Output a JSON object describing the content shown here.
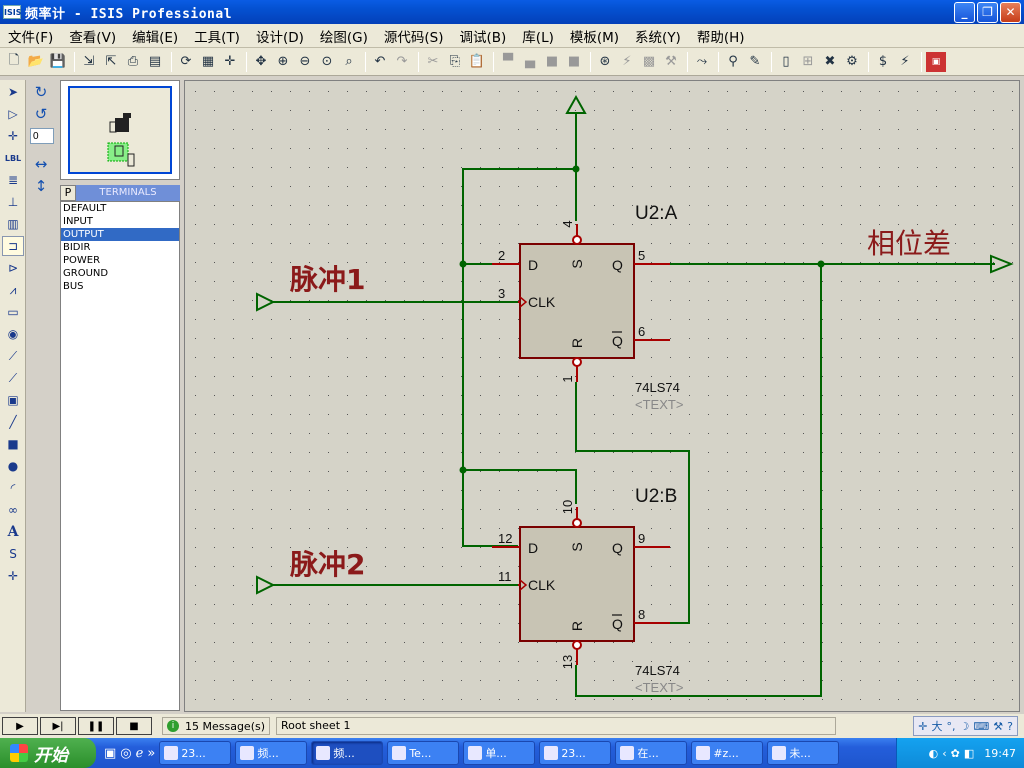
{
  "window": {
    "app_icon": "ISIS",
    "title": "频率计 - ISIS Professional",
    "buttons": [
      "_",
      "❐",
      "✕"
    ]
  },
  "menu": [
    "文件(F)",
    "查看(V)",
    "编辑(E)",
    "工具(T)",
    "设计(D)",
    "绘图(G)",
    "源代码(S)",
    "调试(B)",
    "库(L)",
    "模板(M)",
    "系统(Y)",
    "帮助(H)"
  ],
  "toolbar_icons": [
    "new-file-icon",
    "open-folder-icon",
    "save-icon",
    "import-icon",
    "export-icon",
    "print-icon",
    "print-area-icon",
    "refresh-icon",
    "grid-icon",
    "origin-icon",
    "pan-icon",
    "zoom-in-icon",
    "zoom-out-icon",
    "zoom-all-icon",
    "zoom-area-icon",
    "undo-icon",
    "redo-icon",
    "cut-icon",
    "copy-icon",
    "paste-icon",
    "block-copy-icon",
    "block-move-icon",
    "block-rotate-icon",
    "block-delete-icon",
    "pick-device-icon",
    "make-device-icon",
    "packaging-icon",
    "decompose-icon",
    "wire-autorouter-icon",
    "search-tag-icon",
    "property-assign-icon",
    "new-sheet-icon",
    "remove-sheet-icon",
    "goto-sheet-icon",
    "bill-of-materials-icon",
    "electrical-check-icon",
    "netlist-icon",
    "ares-icon"
  ],
  "rotation_value": "0",
  "device_panel": {
    "pick_button": "P",
    "header": "TERMINALS",
    "items": [
      "DEFAULT",
      "INPUT",
      "OUTPUT",
      "BIDIR",
      "POWER",
      "GROUND",
      "BUS"
    ],
    "selected_index": 2
  },
  "schematic": {
    "u2a": {
      "ref": "U2:A",
      "part": "74LS74",
      "text": "<TEXT>",
      "pins": {
        "d": "2",
        "clk": "3",
        "s": "4",
        "q": "5",
        "qbar": "6",
        "r": "1"
      }
    },
    "u2b": {
      "ref": "U2:B",
      "part": "74LS74",
      "text": "<TEXT>",
      "pins": {
        "d": "12",
        "clk": "11",
        "s": "10",
        "q": "9",
        "qbar": "8",
        "r": "13"
      }
    },
    "pin_labels": {
      "d": "D",
      "clk": "CLK",
      "s": "S",
      "q": "Q",
      "qbar": "Q",
      "r": "R"
    },
    "input1_label": "脉冲1",
    "input2_label": "脉冲2",
    "output_label": "相位差",
    "colors": {
      "wire": "#006400",
      "pin": "#a80000",
      "body": "#c8c4b4",
      "body_stroke": "#7a0000",
      "label": "#8b1a1a"
    }
  },
  "status": {
    "messages": "15 Message(s)",
    "sheet": "Root sheet 1"
  },
  "taskbar": {
    "start": "开始",
    "tasks": [
      "23...",
      "频...",
      "频...",
      "Te...",
      "单...",
      "23...",
      "在...",
      "#z...",
      "未..."
    ],
    "active_index": 2,
    "clock": "19:47"
  }
}
